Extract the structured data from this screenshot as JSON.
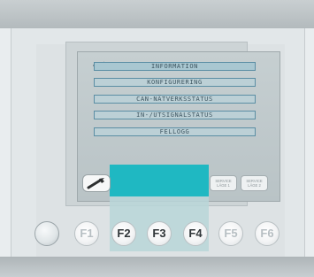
{
  "screen": {
    "menu": {
      "items": [
        {
          "label": "INFORMATION",
          "selected": true
        },
        {
          "label": "KONFIGURERING",
          "selected": false
        },
        {
          "label": "CAN-NÄTVERKSSTATUS",
          "selected": false
        },
        {
          "label": "IN-/UTSIGNALSTATUS",
          "selected": false
        },
        {
          "label": "FELLOGG",
          "selected": false
        }
      ],
      "cursor_icon": "arrow-right-icon"
    },
    "softkeys": {
      "tool_icon": "wrench-icon",
      "service1_line1": "SERVICE",
      "service1_line2": "LÄGE 1",
      "service2_line1": "SERVICE",
      "service2_line2": "LÄGE 2"
    }
  },
  "keypad": {
    "power_icon": "power-knob-icon",
    "f1": "F1",
    "f2": "F2",
    "f3": "F3",
    "f4": "F4",
    "f5": "F5",
    "f6": "F6"
  },
  "colors": {
    "highlight": "#1fb8c2",
    "menu_border": "#5b8ea4",
    "menu_fill": "#bcd0d6"
  }
}
